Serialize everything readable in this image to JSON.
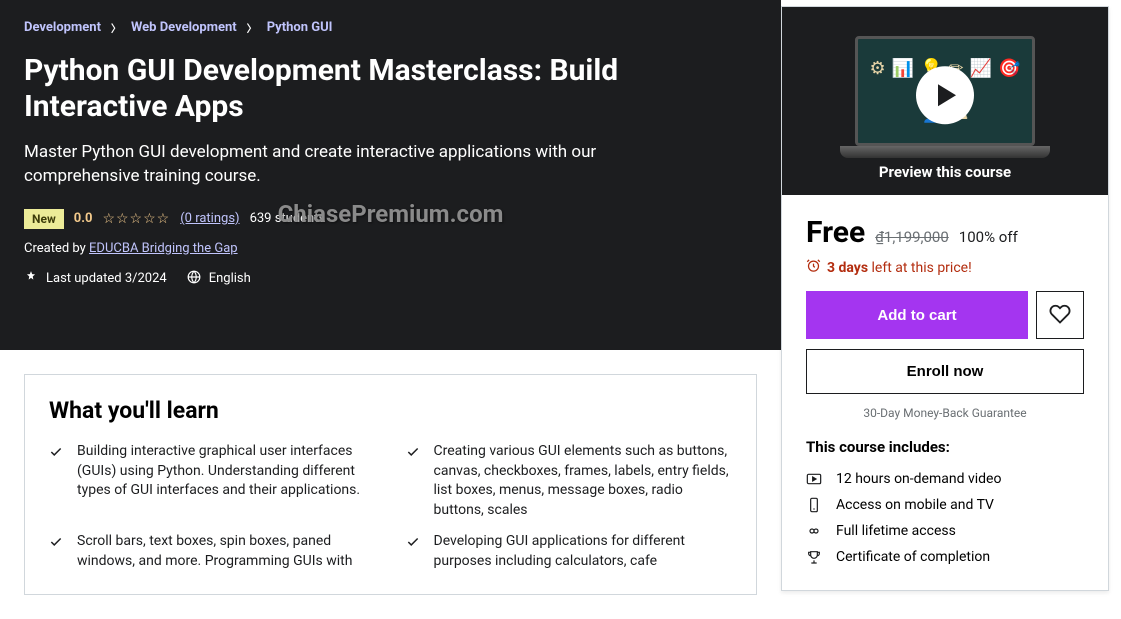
{
  "breadcrumb": {
    "items": [
      "Development",
      "Web Development",
      "Python GUI"
    ]
  },
  "course": {
    "title": "Python GUI Development Masterclass: Build Interactive Apps",
    "subtitle": "Master Python GUI development and create interactive applications with our comprehensive training course.",
    "new_badge": "New",
    "rating": "0.0",
    "stars": "☆☆☆☆☆",
    "ratings_link": "(0 ratings)",
    "students": "639 students",
    "created_by_label": "Created by ",
    "author": "EDUCBA Bridging the Gap",
    "last_updated": "Last updated 3/2024",
    "language": "English"
  },
  "watermark": "ChiasePremium.com",
  "learn": {
    "title": "What you'll learn",
    "items": [
      "Building interactive graphical user interfaces (GUIs) using Python. Understanding different types of GUI interfaces and their applications.",
      "Creating various GUI elements such as buttons, canvas, checkboxes, frames, labels, entry fields, list boxes, menus, message boxes, radio buttons, scales",
      "Scroll bars, text boxes, spin boxes, paned windows, and more. Programming GUIs with",
      "Developing GUI applications for different purposes including calculators, cafe"
    ]
  },
  "sidebar": {
    "preview_label": "Preview this course",
    "price": "Free",
    "old_price": "₫1,199,000",
    "discount": "100% off",
    "urgency_days": "3 days",
    "urgency_rest": " left at this price!",
    "add_to_cart": "Add to cart",
    "enroll": "Enroll now",
    "guarantee": "30-Day Money-Back Guarantee",
    "includes_title": "This course includes:",
    "includes": [
      "12 hours on-demand video",
      "Access on mobile and TV",
      "Full lifetime access",
      "Certificate of completion"
    ]
  }
}
